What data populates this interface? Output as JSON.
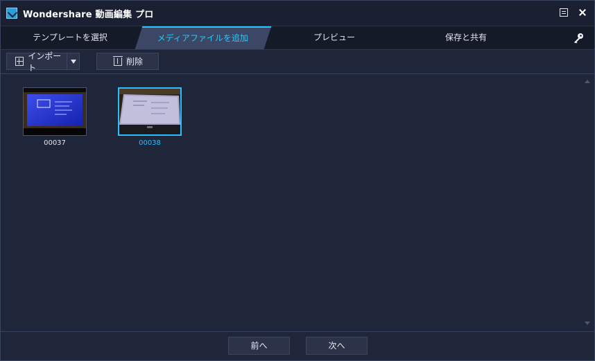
{
  "window": {
    "title": "Wondershare 動画編集 プロ",
    "icons": [
      "app-icon",
      "menu-icon",
      "close-icon"
    ]
  },
  "tabs": [
    {
      "label": "テンプレートを選択",
      "active": false
    },
    {
      "label": "メディアファイルを追加",
      "active": true
    },
    {
      "label": "プレビュー",
      "active": false
    },
    {
      "label": "保存と共有",
      "active": false
    }
  ],
  "tabbar_icon": "key-icon",
  "toolbar": {
    "import_label": "インポート",
    "delete_label": "削除"
  },
  "media": [
    {
      "name": "00037",
      "selected": false
    },
    {
      "name": "00038",
      "selected": true
    }
  ],
  "footer": {
    "prev_label": "前へ",
    "next_label": "次へ"
  },
  "colors": {
    "accent": "#28c8ff",
    "background": "#1f2639",
    "tabbar": "#141a28",
    "active_tab": "#3b4764"
  }
}
